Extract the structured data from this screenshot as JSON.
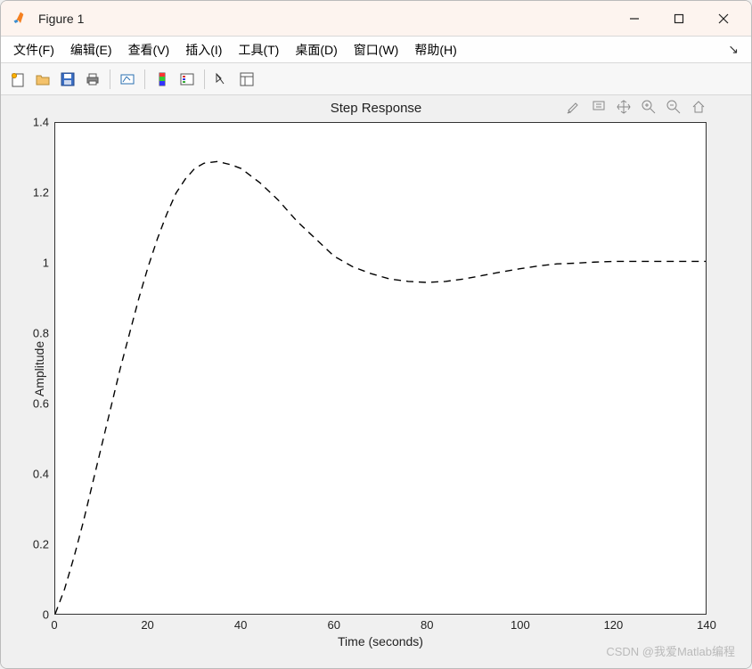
{
  "window": {
    "title": "Figure 1"
  },
  "menu": {
    "file": "文件(F)",
    "edit": "编辑(E)",
    "view": "查看(V)",
    "insert": "插入(I)",
    "tools": "工具(T)",
    "desktop": "桌面(D)",
    "window": "窗口(W)",
    "help": "帮助(H)"
  },
  "chart": {
    "title": "Step Response",
    "xlabel": "Time (seconds)",
    "ylabel": "Amplitude",
    "xticks": [
      "0",
      "20",
      "40",
      "60",
      "80",
      "100",
      "120",
      "140"
    ],
    "yticks": [
      "0",
      "0.2",
      "0.4",
      "0.6",
      "0.8",
      "1",
      "1.2",
      "1.4"
    ]
  },
  "watermark": "CSDN @我爱Matlab编程",
  "chart_data": {
    "type": "line",
    "title": "Step Response",
    "xlabel": "Time (seconds)",
    "ylabel": "Amplitude",
    "xlim": [
      0,
      140
    ],
    "ylim": [
      0,
      1.4
    ],
    "reference": 1.0,
    "series": [
      {
        "name": "response",
        "style": "dashed",
        "color": "#000000",
        "x": [
          0,
          2,
          4,
          6,
          8,
          10,
          12,
          14,
          16,
          18,
          20,
          22,
          24,
          26,
          28,
          30,
          32,
          35,
          38,
          40,
          44,
          48,
          52,
          56,
          60,
          64,
          68,
          72,
          76,
          80,
          84,
          88,
          92,
          96,
          100,
          104,
          108,
          112,
          116,
          120,
          124,
          128,
          132,
          136,
          140
        ],
        "y": [
          0.0,
          0.07,
          0.16,
          0.26,
          0.37,
          0.48,
          0.59,
          0.7,
          0.8,
          0.9,
          0.99,
          1.07,
          1.14,
          1.2,
          1.24,
          1.27,
          1.285,
          1.29,
          1.28,
          1.27,
          1.23,
          1.18,
          1.12,
          1.07,
          1.02,
          0.99,
          0.97,
          0.955,
          0.948,
          0.945,
          0.948,
          0.955,
          0.965,
          0.975,
          0.984,
          0.992,
          0.998,
          1.0,
          1.003,
          1.005,
          1.005,
          1.005,
          1.005,
          1.005,
          1.005
        ]
      }
    ]
  }
}
